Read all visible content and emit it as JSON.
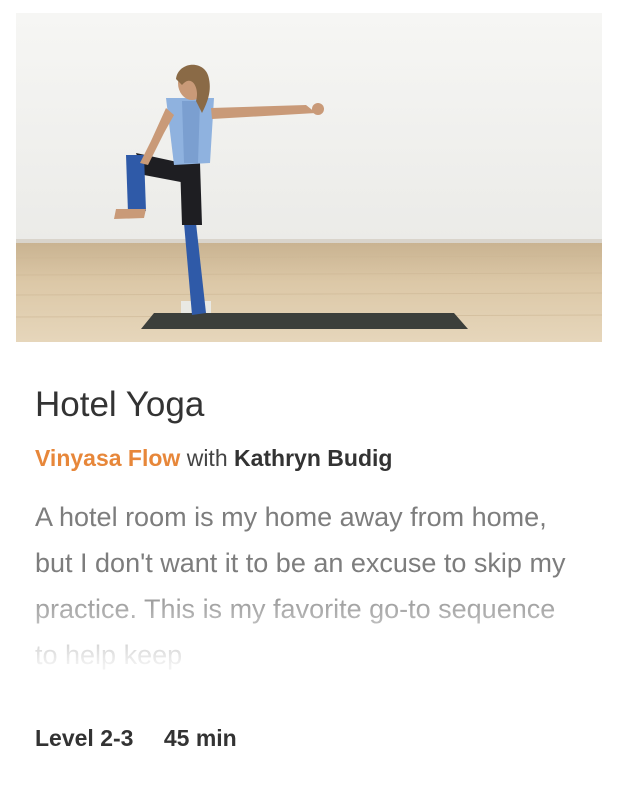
{
  "card": {
    "image": {
      "icon": "yoga-class-thumbnail"
    },
    "title": "Hotel Yoga",
    "style": "Vinyasa Flow",
    "with_word": "with",
    "teacher": "Kathryn Budig",
    "description": "A hotel room is my home away from home, but I don't want it to be an excuse to skip my practice. This is my favorite go-to sequence to help keep",
    "level": "Level 2-3",
    "duration": "45 min"
  },
  "colors": {
    "accent": "#e7873a",
    "title": "#333333",
    "description": "#7d7d7d"
  }
}
